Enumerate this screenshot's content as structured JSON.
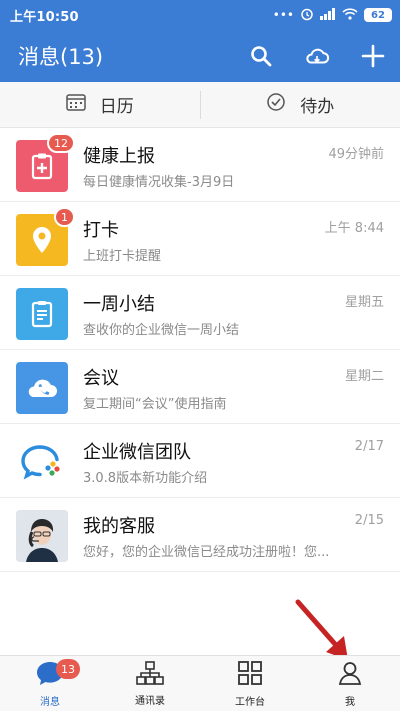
{
  "status_bar": {
    "time": "上午10:50",
    "battery": "62",
    "dots": "•••"
  },
  "app_bar": {
    "title": "消息(13)",
    "icons": [
      "search-icon",
      "cloud-icon",
      "plus-icon"
    ]
  },
  "subtabs": [
    {
      "label": "日历",
      "icon": "calendar-icon"
    },
    {
      "label": "待办",
      "icon": "check-circle-icon"
    }
  ],
  "messages": [
    {
      "name": "健康上报",
      "preview": "每日健康情况收集-3月9日",
      "time": "49分钟前",
      "badge": "12",
      "icon": "clipboard-plus-icon",
      "color": "#ef5b6e"
    },
    {
      "name": "打卡",
      "preview": "上班打卡提醒",
      "time": "上午 8:44",
      "badge": "1",
      "icon": "location-pin-icon",
      "color": "#f5b820"
    },
    {
      "name": "一周小结",
      "preview": "查收你的企业微信一周小结",
      "time": "星期五",
      "badge": "",
      "icon": "document-icon",
      "color": "#3fa9e7"
    },
    {
      "name": "会议",
      "preview": "复工期间“会议”使用指南",
      "time": "星期二",
      "badge": "",
      "icon": "phone-cloud-icon",
      "color": "#4796e6"
    },
    {
      "name": "企业微信团队",
      "preview": "3.0.8版本新功能介绍",
      "time": "2/17",
      "badge": "",
      "icon": "wecom-logo-icon",
      "color": "#ffffff"
    },
    {
      "name": "我的客服",
      "preview": "您好，您的企业微信已经成功注册啦！您...",
      "time": "2/15",
      "badge": "",
      "icon": "customer-service-avatar",
      "color": "#dfe5ea"
    }
  ],
  "bottom_nav": [
    {
      "label": "消息",
      "icon": "chat-bubble-icon",
      "badge": "13",
      "active": true
    },
    {
      "label": "通讯录",
      "icon": "org-chart-icon",
      "badge": "",
      "active": false
    },
    {
      "label": "工作台",
      "icon": "grid-icon",
      "badge": "",
      "active": false
    },
    {
      "label": "我",
      "icon": "person-icon",
      "badge": "",
      "active": false
    }
  ],
  "colors": {
    "brand": "#3b7cd4",
    "badge": "#e65a4f",
    "active_nav": "#2b6dc8",
    "arrow": "#c62323"
  }
}
